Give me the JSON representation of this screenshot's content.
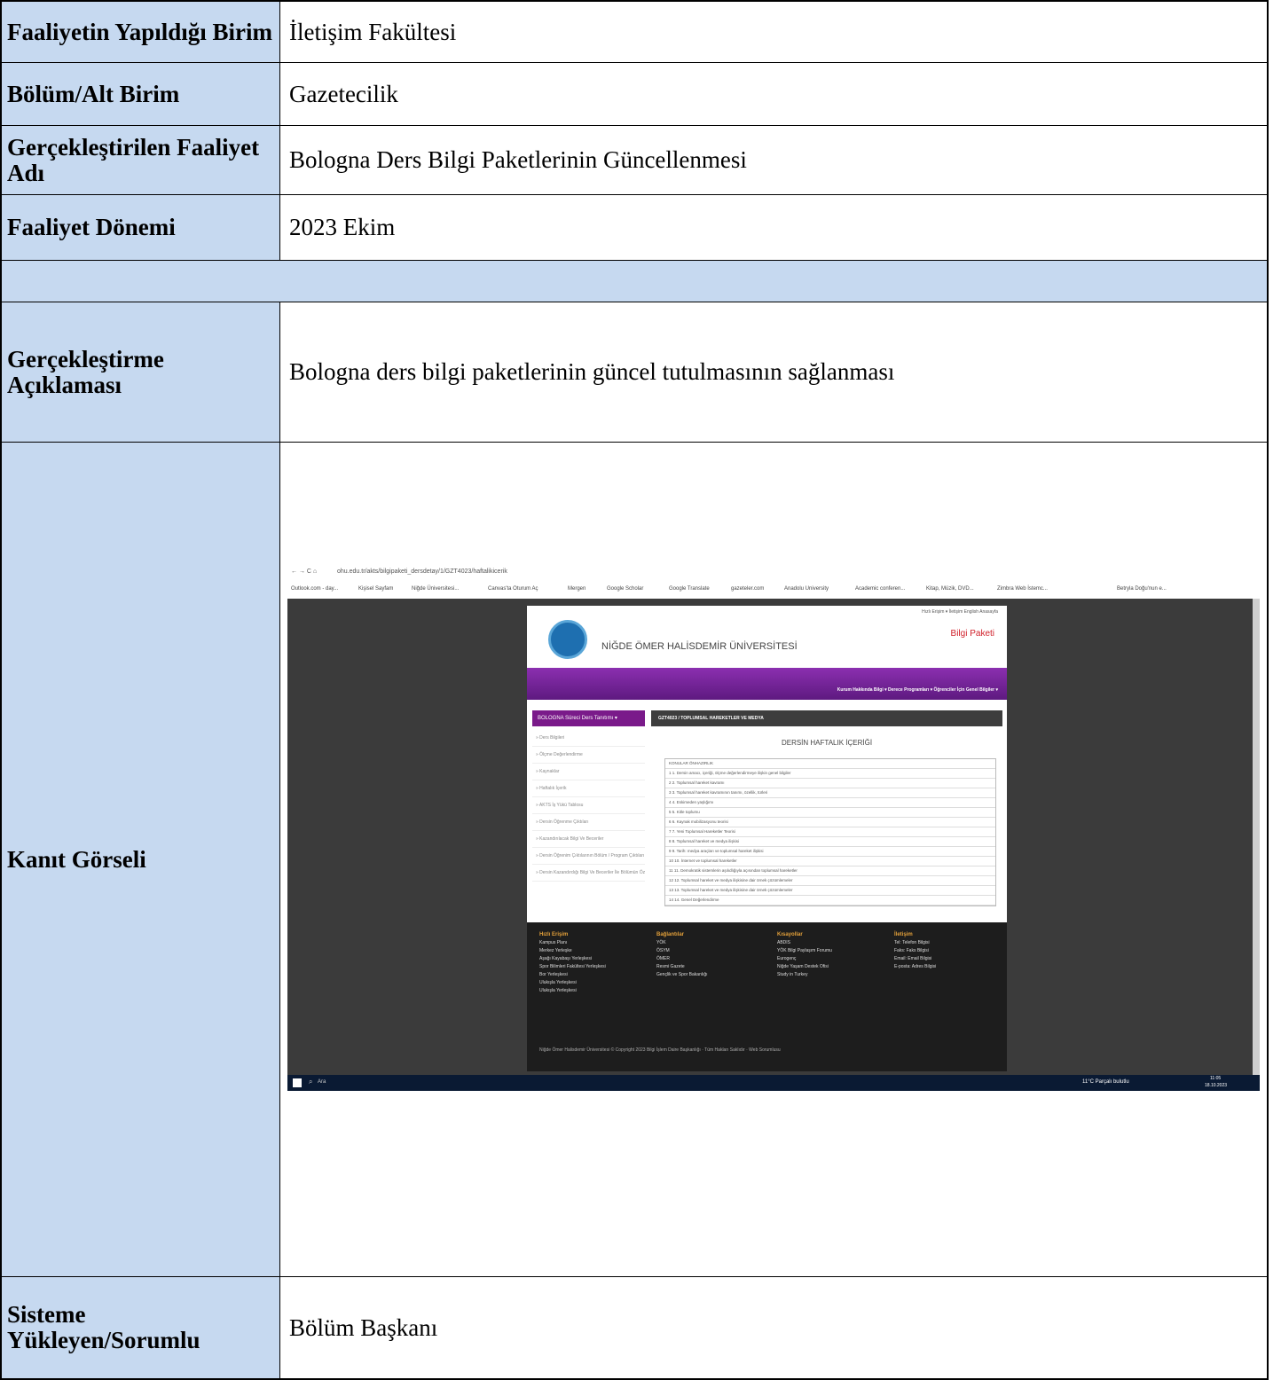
{
  "rows": {
    "r1": {
      "label": "Faaliyetin Yapıldığı Birim",
      "value": "İletişim Fakültesi"
    },
    "r2": {
      "label": "Bölüm/Alt Birim",
      "value": "Gazetecilik"
    },
    "r3": {
      "label": "Gerçekleştirilen Faaliyet Adı",
      "value": "Bologna Ders Bilgi Paketlerinin Güncellenmesi"
    },
    "r4": {
      "label": "Faaliyet Dönemi",
      "value": "2023 Ekim"
    },
    "r5": {
      "label": "Gerçekleştirme Açıklaması",
      "value": "Bologna ders bilgi paketlerinin güncel tutulmasının sağlanması"
    },
    "r6": {
      "label": "Kanıt Görseli"
    },
    "r7": {
      "label": "Sisteme Yükleyen/Sorumlu",
      "value": "Bölüm Başkanı"
    }
  },
  "screenshot": {
    "url": "ohu.edu.tr/akts/bilgipaketi_dersdetay/1/GZT4023/haftalikicerik",
    "bookmarks": [
      "Outlook.com - day...",
      "Kişisel Sayfam",
      "Niğde Üniversitesi...",
      "Canvas'ta Oturum Aç",
      "Mergen",
      "Google Scholar",
      "Google Translate",
      "gazeteler.com",
      "Anadolu University",
      "Academic conferen...",
      "Kitap, Müzik, DVD...",
      "Zimbra Web İstemc...",
      "Betryla Doğu'nun e..."
    ],
    "university": "NİĞDE ÖMER HALİSDEMİR ÜNİVERSİTESİ",
    "bilgi_paketi": "Bilgi Paketi",
    "top_links": "Hızlı Erişim ▾   İletişim   English   Anasayfa",
    "nav": "Kurum Hakkında Bilgi ▾    Derece Programları ▾    Öğrenciler İçin Genel Bilgiler ▾",
    "side_button": "BOLOGNA Süreci Ders Tanıtımı ▾",
    "side_items": [
      "» Ders Bilgileri",
      "» Ölçme Değerlendirme",
      "» Kaynaklar",
      "» Haftalık İçerik",
      "» AKTS İş Yükü Tablosu",
      "» Dersin Öğrenme Çıktıları",
      "» Kazandırılacak Bilgi Ve Beceriler",
      "» Dersin Öğrenim Çıktılarının Bölüm / Program Çıktıları İle İlişkilendirilmesi",
      "» Dersin Kazandırdığı Bilgi Ve Beceriler İle Bölümün Özgü Genel Yeterlilikleri İlişkilendirilmesi"
    ],
    "course_header": "GZT4023 / TOPLUMSAL HAREKETLER VE MEDYA",
    "weekly_title": "DERSİN HAFTALIK İÇERİĞİ",
    "weekly_rows": [
      "KONULAR                                                                          ÖNHAZIRLIK",
      "1  1. Dersin amacı, içeriği, ölçme değerlendirmeye ilişkin genel bilgiler",
      "2  2. Toplumsal hareket kavramı",
      "3  3. Toplumsal hareket kavramının tanımı, özellik, türleri",
      "4  4. Eskimeden yaşlığımı",
      "5  5. Kitle toplumu",
      "6  6. Kaynak mobilizasyonu teorisi",
      "7  7. Yeni Toplumsal Hareketler Teorisi",
      "8  8. Toplumsal hareket ve medya ilişkisi",
      "9  9. Tarih: medya araçları ve toplumsal hareket ilişkisi",
      "10  10. İnternet ve toplumsal hareketler",
      "11  11. Demokratik sistemlerin aşılıdlığıyla açısından toplumsal hareketler",
      "12  12. Toplumsal hareket ve medya ilişkisine dair örnek çözümlemeler",
      "13  13. Toplumsal hareket ve medya ilişkisine dair örnek çözümlemeler",
      "14  14. Genel Değerlendirme"
    ],
    "footer": {
      "col1": {
        "title": "Hızlı Erişim",
        "items": [
          "Kampus Planı",
          "Merkez Yerleşke",
          "Aşağı Kayabaşı Yerleşkesi",
          "Spor Bilimleri Fakültesi Yerleşkesi",
          "Bor Yerleşkesi",
          "Ulukışla Yerleşkesi",
          "Ulukışla Yerleşkesi"
        ]
      },
      "col2": {
        "title": "Bağlantılar",
        "items": [
          "YÖK",
          "ÖSYM",
          "ÖMER",
          "Resmi Gazete",
          "Gençlik ve Spor Bakanlığı"
        ]
      },
      "col3": {
        "title": "Kısayollar",
        "items": [
          "ABDIS",
          "YÖK Bilgi Paylaşım Forumu",
          "Eurogenç",
          "Niğde Yaşam Destek Ofisi",
          "Study in Turkey"
        ]
      },
      "col4": {
        "title": "İletişim",
        "items": [
          "Tel: Telefon Bilgisi",
          "Faks: Faks Bilgisi",
          "Email: Email Bilgisi",
          "E-posta: Adres Bilgisi"
        ]
      },
      "bottom": "Niğde Ömer Halisdemir Üniversitesi    © Copyright 2023  Bilgi İşlem Daire Başkanlığı  ·  Tüm Hakları Saklıdır  ·  Web Sorumlusu"
    },
    "taskbar": {
      "search": "Ara",
      "weather": "11°C Parçalı bulutlu",
      "time": "11:05",
      "date": "18.10.2023"
    }
  }
}
